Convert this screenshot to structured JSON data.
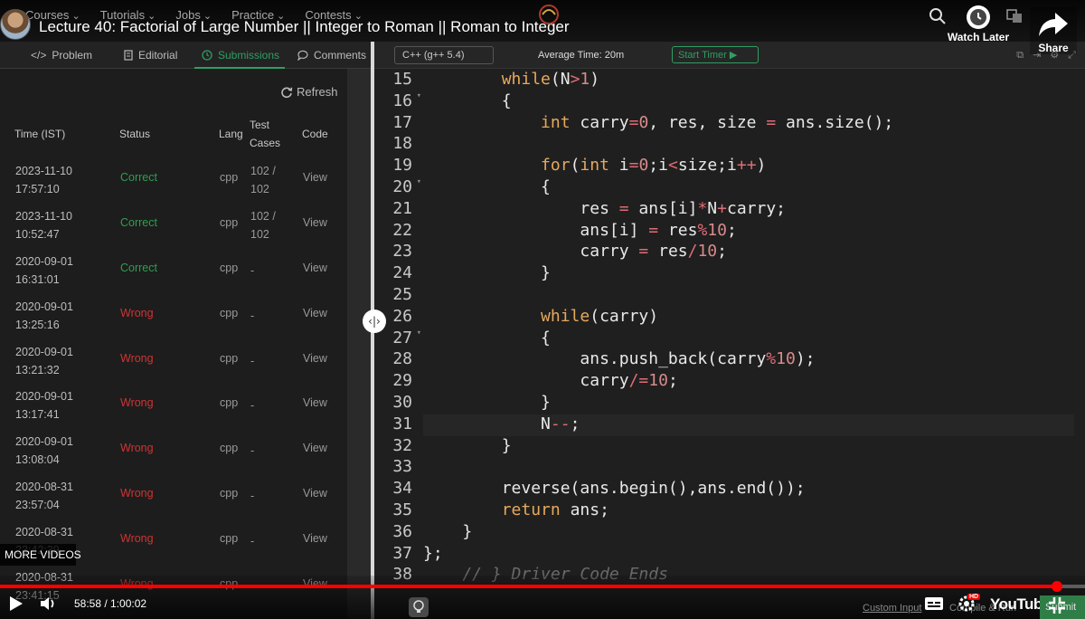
{
  "gfg_nav": {
    "items": [
      "Courses",
      "Tutorials",
      "Jobs",
      "Practice",
      "Contests"
    ]
  },
  "video": {
    "title": "Lecture 40: Factorial of Large Number || Integer to Roman || Roman to Integer",
    "watch_later_label": "Watch Later",
    "share_label": "Share",
    "more_videos_label": "MORE VIDEOS",
    "current_time": "58:58",
    "duration": "1:00:02",
    "time_display": "58:58 / 1:00:02",
    "progress": 0.974,
    "brand_label": "YouTube",
    "hd_badge": "HD"
  },
  "tabs": [
    {
      "label": "Problem",
      "icon": "code-icon",
      "active": false
    },
    {
      "label": "Editorial",
      "icon": "document-icon",
      "active": false
    },
    {
      "label": "Submissions",
      "icon": "clock-icon",
      "active": true
    },
    {
      "label": "Comments",
      "icon": "chat-icon",
      "active": false
    }
  ],
  "submissions": {
    "refresh_label": "Refresh",
    "headers": {
      "time": "Time (IST)",
      "status": "Status",
      "lang": "Lang",
      "test_cases_line1": "Test",
      "test_cases_line2": "Cases",
      "code": "Code"
    },
    "rows": [
      {
        "date": "2023-11-10",
        "time": "17:57:10",
        "status": "Correct",
        "lang": "cpp",
        "test_cases_line1": "102 /",
        "test_cases_line2": "102",
        "code": "View"
      },
      {
        "date": "2023-11-10",
        "time": "10:52:47",
        "status": "Correct",
        "lang": "cpp",
        "test_cases_line1": "102 /",
        "test_cases_line2": "102",
        "code": "View"
      },
      {
        "date": "2020-09-01",
        "time": "16:31:01",
        "status": "Correct",
        "lang": "cpp",
        "test_cases_line1": "-",
        "test_cases_line2": "",
        "code": "View"
      },
      {
        "date": "2020-09-01",
        "time": "13:25:16",
        "status": "Wrong",
        "lang": "cpp",
        "test_cases_line1": "-",
        "test_cases_line2": "",
        "code": "View"
      },
      {
        "date": "2020-09-01",
        "time": "13:21:32",
        "status": "Wrong",
        "lang": "cpp",
        "test_cases_line1": "-",
        "test_cases_line2": "",
        "code": "View"
      },
      {
        "date": "2020-09-01",
        "time": "13:17:41",
        "status": "Wrong",
        "lang": "cpp",
        "test_cases_line1": "-",
        "test_cases_line2": "",
        "code": "View"
      },
      {
        "date": "2020-09-01",
        "time": "13:08:04",
        "status": "Wrong",
        "lang": "cpp",
        "test_cases_line1": "-",
        "test_cases_line2": "",
        "code": "View"
      },
      {
        "date": "2020-08-31",
        "time": "23:57:04",
        "status": "Wrong",
        "lang": "cpp",
        "test_cases_line1": "-",
        "test_cases_line2": "",
        "code": "View"
      },
      {
        "date": "2020-08-31",
        "time": "23:42:39",
        "status": "Wrong",
        "lang": "cpp",
        "test_cases_line1": "-",
        "test_cases_line2": "",
        "code": "View"
      },
      {
        "date": "2020-08-31",
        "time": "23:41:15",
        "status": "Wrong",
        "lang": "cpp",
        "test_cases_line1": "-",
        "test_cases_line2": "",
        "code": "View"
      }
    ]
  },
  "editor": {
    "language": "C++ (g++ 5.4)",
    "average_time": "Average Time: 20m",
    "start_timer_label": "Start Timer",
    "custom_input_label": "Custom Input",
    "compile_run_label": "Compile & Run",
    "submit_label": "Submit",
    "lines": [
      {
        "n": "15",
        "fold": false,
        "code": "        while(N>1)"
      },
      {
        "n": "16",
        "fold": true,
        "code": "        {"
      },
      {
        "n": "17",
        "fold": false,
        "code": "            int carry=0, res, size = ans.size();"
      },
      {
        "n": "18",
        "fold": false,
        "code": ""
      },
      {
        "n": "19",
        "fold": false,
        "code": "            for(int i=0;i<size;i++)"
      },
      {
        "n": "20",
        "fold": true,
        "code": "            {"
      },
      {
        "n": "21",
        "fold": false,
        "code": "                res = ans[i]*N+carry;"
      },
      {
        "n": "22",
        "fold": false,
        "code": "                ans[i] = res%10;"
      },
      {
        "n": "23",
        "fold": false,
        "code": "                carry = res/10;"
      },
      {
        "n": "24",
        "fold": false,
        "code": "            }"
      },
      {
        "n": "25",
        "fold": false,
        "code": ""
      },
      {
        "n": "26",
        "fold": false,
        "code": "            while(carry)"
      },
      {
        "n": "27",
        "fold": true,
        "code": "            {"
      },
      {
        "n": "28",
        "fold": false,
        "code": "                ans.push_back(carry%10);"
      },
      {
        "n": "29",
        "fold": false,
        "code": "                carry/=10;"
      },
      {
        "n": "30",
        "fold": false,
        "code": "            }"
      },
      {
        "n": "31",
        "fold": false,
        "code": "            N--;"
      },
      {
        "n": "32",
        "fold": false,
        "code": "        }"
      },
      {
        "n": "33",
        "fold": false,
        "code": ""
      },
      {
        "n": "34",
        "fold": false,
        "code": "        reverse(ans.begin(),ans.end());"
      },
      {
        "n": "35",
        "fold": false,
        "code": "        return ans;"
      },
      {
        "n": "36",
        "fold": false,
        "code": "    }"
      },
      {
        "n": "37",
        "fold": false,
        "code": "};"
      },
      {
        "n": "38",
        "fold": false,
        "code": "    // } Driver Code Ends"
      }
    ],
    "highlighted_line": "31"
  },
  "colors": {
    "accent_green": "#2f9e62",
    "correct": "#2f9e4f",
    "wrong": "#d03333",
    "yt_red": "#ff0000",
    "keyword": "#e6a95c",
    "operator": "#e06c75",
    "number": "#d88a8a"
  }
}
